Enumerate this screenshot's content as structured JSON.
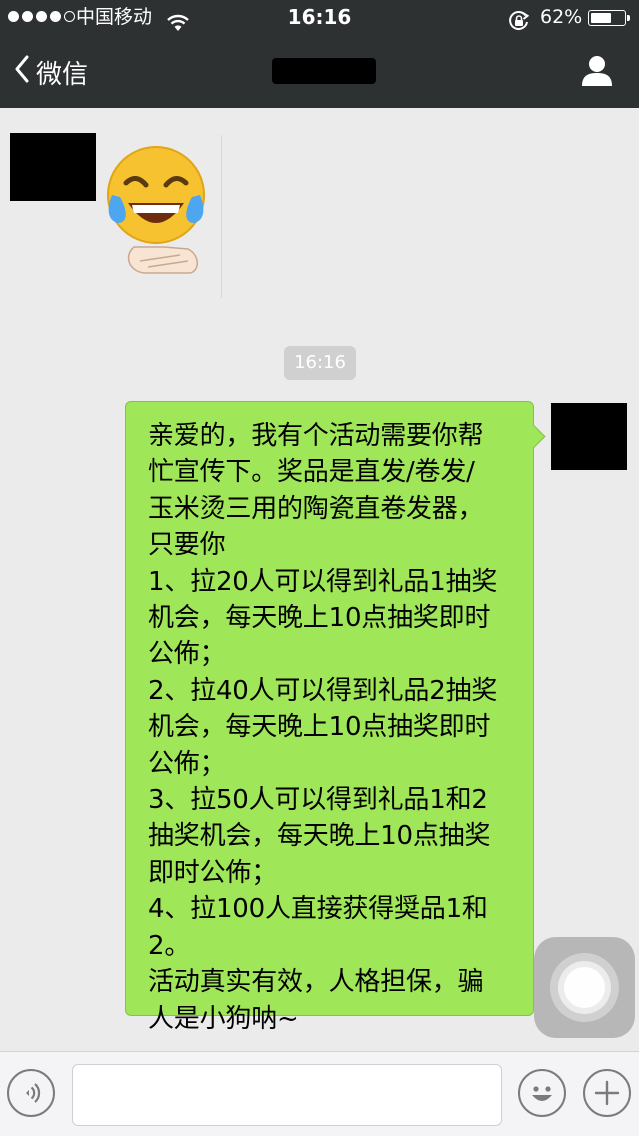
{
  "status_bar": {
    "carrier": "中国移动",
    "time": "16:16",
    "battery_percent": "62%",
    "battery_level": 0.62,
    "signal_bars_filled": 4,
    "signal_bars_total": 5
  },
  "nav": {
    "back_label": "微信"
  },
  "chat": {
    "received_sticker": "face-with-tears-of-joy-sticker",
    "timestamp": "16:16",
    "sent_message_lines": [
      "亲爱的，我有个活动需要你帮",
      "忙宣传下。奖品是直发/卷发/",
      "玉米烫三用的陶瓷直卷发器，",
      "只要你",
      "1、拉20人可以得到礼品1抽奖",
      "机会，每天晚上10点抽奖即时",
      "公佈；",
      "2、拉40人可以得到礼品2抽奖",
      "机会，每天晚上10点抽奖即时",
      "公佈；",
      "3、拉50人可以得到礼品1和2",
      "抽奖机会，每天晚上10点抽奖",
      "即时公佈；",
      "4、拉100人直接获得奨品1和",
      "2。",
      "活动真实有效，人格担保，骗",
      "人是小狗呐~"
    ]
  },
  "input_bar": {
    "text_value": "",
    "icons": [
      "voice-icon",
      "emoji-icon",
      "plus-icon"
    ]
  },
  "colors": {
    "nav_bg": "#2e3132",
    "chat_bg": "#ebebeb",
    "bubble_green": "#9fe658",
    "timestamp_bg": "#d0d0d0"
  }
}
